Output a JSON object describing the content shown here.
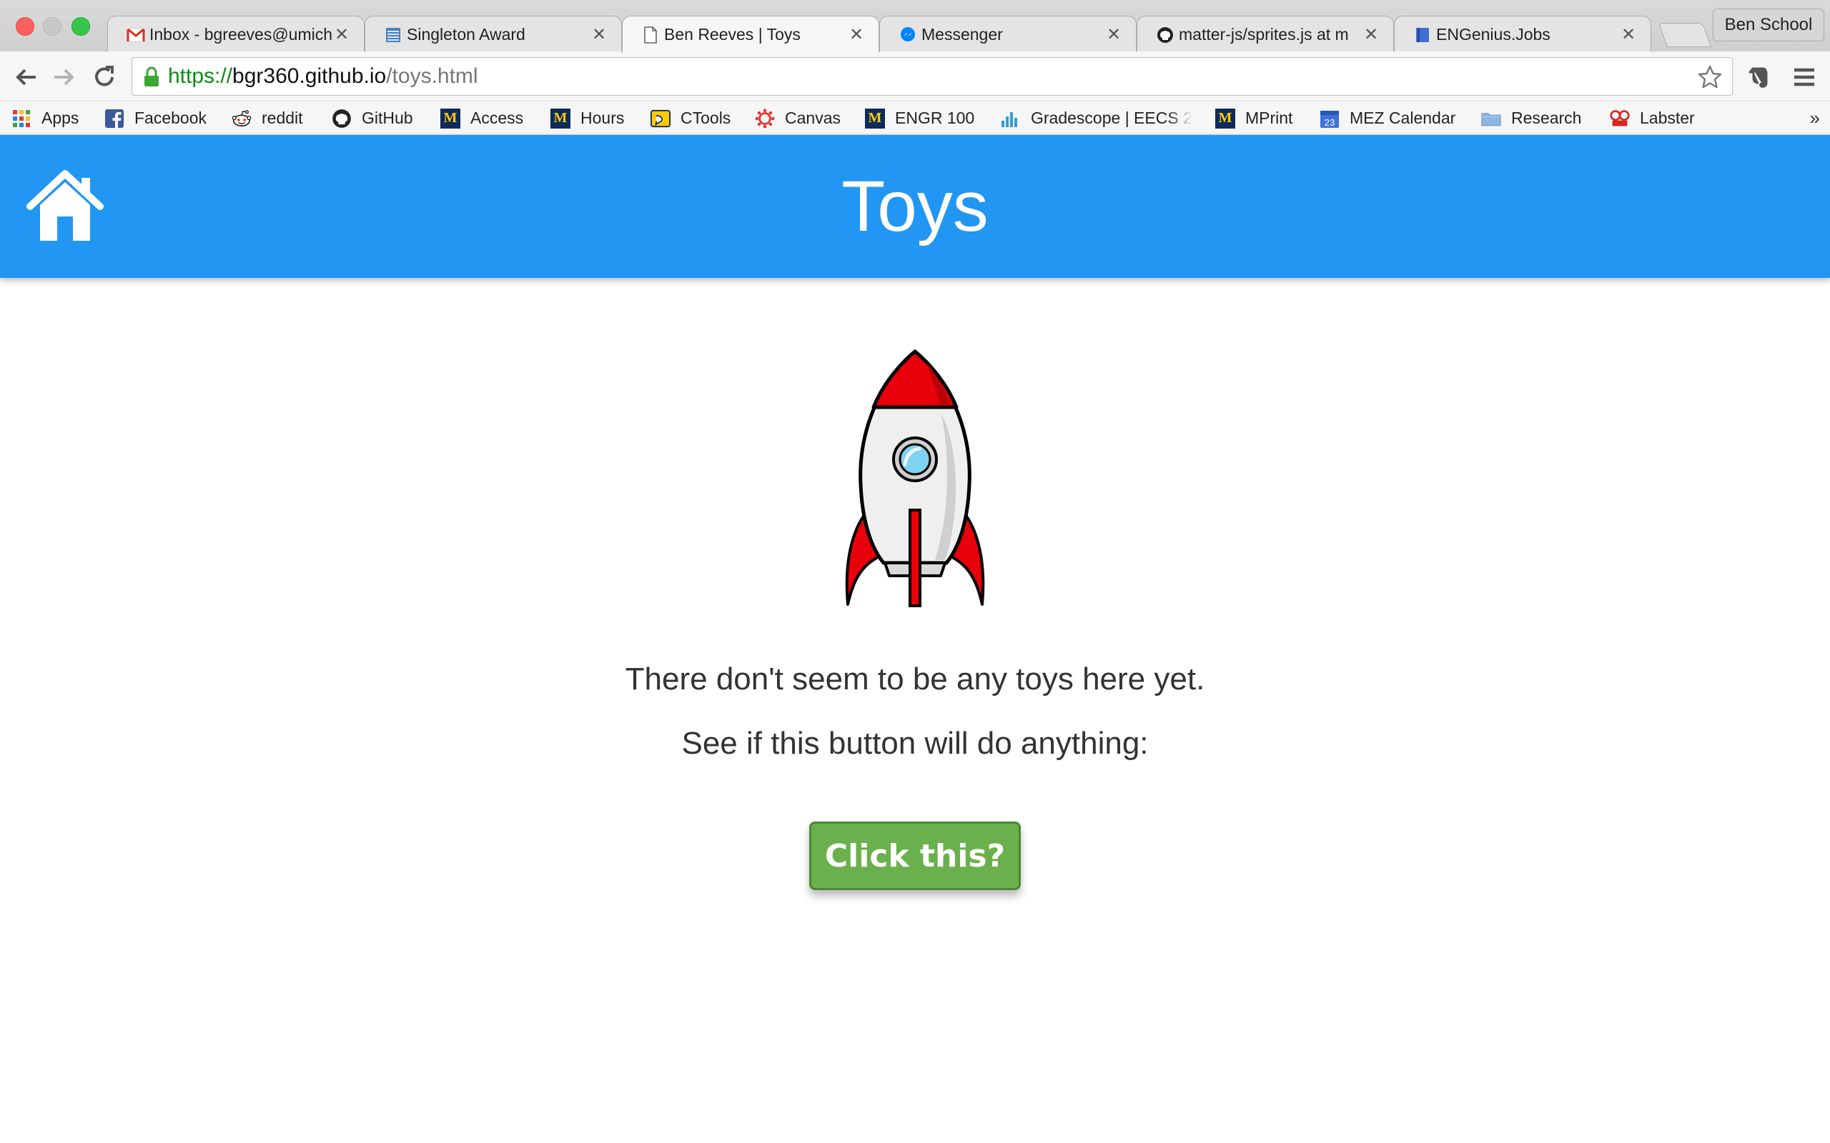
{
  "browser": {
    "tabs": [
      {
        "title": "Inbox - bgreeves@umich",
        "icon": "gmail-icon"
      },
      {
        "title": "Singleton Award",
        "icon": "sheet-icon"
      },
      {
        "title": "Ben Reeves | Toys",
        "icon": "page-icon",
        "active": true
      },
      {
        "title": "Messenger",
        "icon": "messenger-icon"
      },
      {
        "title": "matter-js/sprites.js at m",
        "icon": "github-icon"
      },
      {
        "title": "ENGenius.Jobs",
        "icon": "book-icon"
      }
    ],
    "tab_close_glyph": "✕",
    "profile_name": "Ben School",
    "url": {
      "scheme": "https://",
      "host": "bgr360.github.io",
      "path": "/toys.html"
    },
    "bookmarks": [
      {
        "label": "Apps",
        "icon": "apps-grid-icon"
      },
      {
        "label": "Facebook",
        "icon": "facebook-icon"
      },
      {
        "label": "reddit",
        "icon": "reddit-icon"
      },
      {
        "label": "GitHub",
        "icon": "github-icon"
      },
      {
        "label": "Access",
        "icon": "michigan-m-icon"
      },
      {
        "label": "Hours",
        "icon": "michigan-m-icon"
      },
      {
        "label": "CTools",
        "icon": "ctools-icon"
      },
      {
        "label": "Canvas",
        "icon": "canvas-icon"
      },
      {
        "label": "ENGR 100",
        "icon": "michigan-m-icon"
      },
      {
        "label": "Gradescope | EECS 2",
        "icon": "gradescope-icon"
      },
      {
        "label": "MPrint",
        "icon": "michigan-m-icon"
      },
      {
        "label": "MEZ Calendar",
        "icon": "calendar-icon"
      },
      {
        "label": "Research",
        "icon": "folder-icon"
      },
      {
        "label": "Labster",
        "icon": "labster-icon"
      }
    ],
    "calendar_day": "23",
    "more_glyph": "»"
  },
  "page": {
    "title": "Toys",
    "message_line1": "There don't seem to be any toys here yet.",
    "message_line2": "See if this button will do anything:",
    "button_label": "Click this?"
  },
  "colors": {
    "header": "#2196f3",
    "button": "#6ab04c",
    "rocket_red": "#e8000b"
  }
}
